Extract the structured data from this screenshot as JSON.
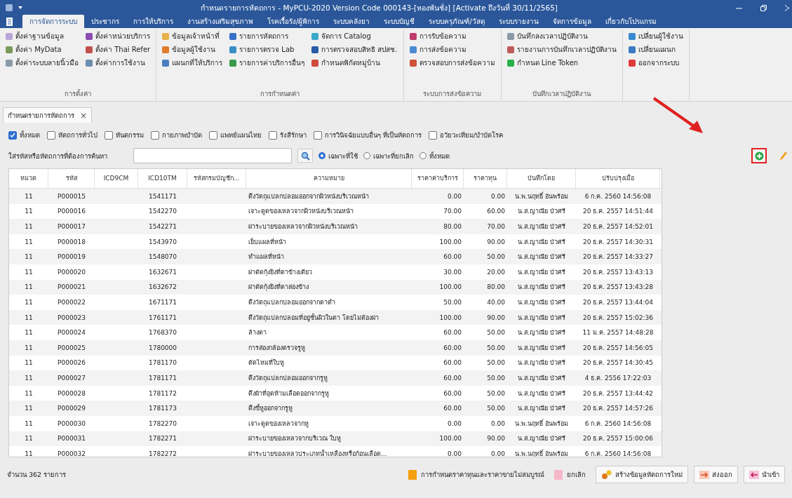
{
  "window": {
    "title": "กำหนดรายการหัตถการ - MyPCU-2020 Version Code 000143-[หองพันชั่ง] [Activate ถึงวันที่ 30/11/2565]"
  },
  "menu_tabs": [
    {
      "label": "การจัดการระบบ",
      "selected": true
    },
    {
      "label": "ประชากร",
      "selected": false
    },
    {
      "label": "การให้บริการ",
      "selected": false
    },
    {
      "label": "งานสร้างเสริมสุขภาพ",
      "selected": false
    },
    {
      "label": "โรคเรื้อรัง/ผู้พิการ",
      "selected": false
    },
    {
      "label": "ระบบคลังยา",
      "selected": false
    },
    {
      "label": "ระบบบัญชี",
      "selected": false
    },
    {
      "label": "ระบบครุภัณฑ์/วัสดุ",
      "selected": false
    },
    {
      "label": "ระบบรายงาน",
      "selected": false
    },
    {
      "label": "จัดการข้อมูล",
      "selected": false
    },
    {
      "label": "เกี่ยวกับโปรแกรม",
      "selected": false
    }
  ],
  "ribbon_groups": [
    {
      "label": "การตั้งค่า",
      "items": [
        {
          "label": "ตั้งค่าฐานข้อมูล",
          "color": "#b9a6d6"
        },
        {
          "label": "ตั้งค่า MyData",
          "color": "#7a9a5a"
        },
        {
          "label": "ตั้งค่าระบบลายนิ้วมือ",
          "color": "#8c9aa8"
        },
        {
          "label": "ตั้งค่าหน่วยบริการ",
          "color": "#8a4fb0"
        },
        {
          "label": "ตั้งค่า Thai Refer",
          "color": "#c0504d"
        },
        {
          "label": "ตั้งค่าการใช้งาน",
          "color": "#6b8cae"
        }
      ]
    },
    {
      "label": "การกำหนดค่า",
      "items": [
        {
          "label": "ข้อมูลเจ้าหน้าที่",
          "color": "#e8b04a"
        },
        {
          "label": "ข้อมูลผู้ใช้งาน",
          "color": "#e07b2a"
        },
        {
          "label": "แผนกที่ให้บริการ",
          "color": "#4a7fc1"
        },
        {
          "label": "รายการหัตถการ",
          "color": "#3a6fc8"
        },
        {
          "label": "รายการตรวจ Lab",
          "color": "#3a8fc8"
        },
        {
          "label": "รายการค่าบริการอื่นๆ",
          "color": "#3a9a4a"
        },
        {
          "label": "จัดการ Catalog",
          "color": "#3aa8c8"
        },
        {
          "label": "การตรวจสอบสิทธิ สปสช.",
          "color": "#2a5aa8"
        },
        {
          "label": "กำหนดพิกัดหมู่บ้าน",
          "color": "#d04a3a"
        }
      ]
    },
    {
      "label": "ระบบการส่งข้อความ",
      "items": [
        {
          "label": "การรับข้อความ",
          "color": "#c03a6a"
        },
        {
          "label": "การส่งข้อความ",
          "color": "#4a8ad0"
        },
        {
          "label": "ตรวจสอบการส่งข้อความ",
          "color": "#d0503a"
        }
      ]
    },
    {
      "label": "บันทึกเวลาปฏิบัติงาน",
      "items": [
        {
          "label": "บันทึกลงเวลาปฏิบัติงาน",
          "color": "#8c9aa8"
        },
        {
          "label": "รายงานการบันทึกเวลาปฏิบัติงาน",
          "color": "#c05a5a"
        },
        {
          "label": "กำหนด Line Token",
          "color": "#2ab04a"
        }
      ]
    },
    {
      "items": [
        {
          "label": "เปลี่ยนผู้ใช้งาน",
          "color": "#3a8ad0"
        },
        {
          "label": "เปลี่ยนแผนก",
          "color": "#3a7ac0"
        },
        {
          "label": "ออกจากระบบ",
          "color": "#e03a3a"
        }
      ]
    }
  ],
  "document_tab": {
    "label": "กำหนดรายการหัตถการ",
    "close": "×"
  },
  "filters": [
    {
      "label": "ทั้งหมด",
      "checked": true
    },
    {
      "label": "หัตถการทั่วไป",
      "checked": false
    },
    {
      "label": "ทันตกรรม",
      "checked": false
    },
    {
      "label": "กายภาพบำบัด",
      "checked": false
    },
    {
      "label": "แพทย์แผนไทย",
      "checked": false
    },
    {
      "label": "รังสีรักษา",
      "checked": false
    },
    {
      "label": "การวินิจฉัยแบบอื่นๆ ที่เป็นหัตถการ",
      "checked": false
    },
    {
      "label": "อวัยวะเทียม/บำบัดโรค",
      "checked": false
    }
  ],
  "search": {
    "label": "ใส่รหัสหรือหัตถการที่ต้องการค้นหา"
  },
  "status_options": [
    {
      "label": "เฉพาะที่ใช้",
      "selected": true
    },
    {
      "label": "เฉพาะที่ยกเลิก",
      "selected": false
    },
    {
      "label": "ทั้งหมด",
      "selected": false
    }
  ],
  "table": {
    "columns": [
      "หมวด",
      "รหัส",
      "ICD9CM",
      "ICD10TM",
      "รหัสกรมบัญชีก...",
      "ความหมาย",
      "ราคาค่าบริการ",
      "ราคาทุน",
      "บันทึกโดย",
      "ปรับปรุงเมื่อ"
    ],
    "rows": [
      [
        "11",
        "P000015",
        "",
        "1541171",
        "",
        "ดึงวัตถุแปลกปลอมออกจากผิวหนังบริเวณหน้า",
        "0.00",
        "0.00",
        "น.พ.นฤทธิ์ อันพร้อม",
        "6 ก.ค. 2560 14:56:08"
      ],
      [
        "11",
        "P000016",
        "",
        "1542270",
        "",
        "เจาะดูดของเหลวจากผิวหนังบริเวณหน้า",
        "70.00",
        "60.00",
        "น.ส.ญาณีย บัวศรี",
        "20 ธ.ค. 2557 14:51:44"
      ],
      [
        "11",
        "P000017",
        "",
        "1542271",
        "",
        "ผ่าระบายของเหลวจากผิวหนังบริเวณหน้า",
        "80.00",
        "70.00",
        "น.ส.ญาณีย บัวศรี",
        "20 ธ.ค. 2557 14:52:01"
      ],
      [
        "11",
        "P000018",
        "",
        "1543970",
        "",
        "เย็บแผลที่หน้า",
        "100.00",
        "90.00",
        "น.ส.ญาณีย บัวศรี",
        "20 ธ.ค. 2557 14:30:31"
      ],
      [
        "11",
        "P000019",
        "",
        "1548070",
        "",
        "ทำแผลที่หน้า",
        "60.00",
        "50.00",
        "น.ส.ญาณีย บัวศรี",
        "20 ธ.ค. 2557 14:33:27"
      ],
      [
        "11",
        "P000020",
        "",
        "1632671",
        "",
        "ผ่าตัดกุ้งยิงที่ตาข้างเดียว",
        "30.00",
        "20.00",
        "น.ส.ญาณีย บัวศรี",
        "20 ธ.ค. 2557 13:43:13"
      ],
      [
        "11",
        "P000021",
        "",
        "1632672",
        "",
        "ผ่าตัดกุ้งยิงที่ตาสองข้าง",
        "100.00",
        "80.00",
        "น.ส.ญาณีย บัวศรี",
        "20 ธ.ค. 2557 13:43:28"
      ],
      [
        "11",
        "P000022",
        "",
        "1671171",
        "",
        "ดึงวัตถุแปลกปลอมออกจากตาดำ",
        "50.00",
        "40.00",
        "น.ส.ญาณีย บัวศรี",
        "20 ธ.ค. 2557 13:44:04"
      ],
      [
        "11",
        "P000023",
        "",
        "1761171",
        "",
        "ดึงวัตถุแปลกปลอมที่อยู่ชั้นผิวในตา โดยไม่ต้องผ่า",
        "100.00",
        "90.00",
        "น.ส.ญาณีย บัวศรี",
        "20 ธ.ค. 2557 15:02:36"
      ],
      [
        "11",
        "P000024",
        "",
        "1768370",
        "",
        "ล้างตา",
        "60.00",
        "50.00",
        "น.ส.ญาณีย บัวศรี",
        "11 ม.ค. 2557 14:48:28"
      ],
      [
        "11",
        "P000025",
        "",
        "1780000",
        "",
        "การส่องกล้องตรวจรูหู",
        "60.00",
        "50.00",
        "น.ส.ญาณีย บัวศรี",
        "20 ธ.ค. 2557 14:56:05"
      ],
      [
        "11",
        "P000026",
        "",
        "1781170",
        "",
        "ตัดไหมที่ใบหู",
        "60.00",
        "50.00",
        "น.ส.ญาณีย บัวศรี",
        "20 ธ.ค. 2557 14:30:45"
      ],
      [
        "11",
        "P000027",
        "",
        "1781171",
        "",
        "ดึงวัตถุแปลกปลอมออกจากรูหู",
        "60.00",
        "50.00",
        "น.ส.ญาณีย บัวศรี",
        "4 ธ.ค. 2556 17:22:03"
      ],
      [
        "11",
        "P000028",
        "",
        "1781172",
        "",
        "ดึงผ้าที่อุดห้ามเลือดออกจากรูหู",
        "60.00",
        "50.00",
        "น.ส.ญาณีย บัวศรี",
        "20 ธ.ค. 2557 13:44:42"
      ],
      [
        "11",
        "P000029",
        "",
        "1781173",
        "",
        "ดึงขี้หูออกจากรูหู",
        "60.00",
        "50.00",
        "น.ส.ญาณีย บัวศรี",
        "20 ธ.ค. 2557 14:57:26"
      ],
      [
        "11",
        "P000030",
        "",
        "1782270",
        "",
        "เจาะดูดของเหลวจากหู",
        "0.00",
        "0.00",
        "น.พ.นฤทธิ์ อันพร้อม",
        "6 ก.ค. 2560 14:56:08"
      ],
      [
        "11",
        "P000031",
        "",
        "1782271",
        "",
        "ผ่าระบายของเหลวจากบริเวณ ใบหู",
        "100.00",
        "90.00",
        "น.ส.ญาณีย บัวศรี",
        "20 ธ.ค. 2557 15:00:06"
      ],
      [
        "11",
        "P000032",
        "",
        "1782272",
        "",
        "ผ่าระบายของเหลวประเภทน้ำเหลืองหรือก้อนเลือด...",
        "0.00",
        "0.00",
        "น.พ.นฤทธิ์ อันพร้อม",
        "6 ก.ค. 2560 14:56:08"
      ]
    ]
  },
  "footer": {
    "count": "จำนวน 362 รายการ",
    "legend": [
      {
        "label": "การกำหนดราคาทุนและราคาขายไม่สมบูรณ์",
        "color": "#f5a00f"
      },
      {
        "label": "ยกเลิก",
        "color": "#f6b8c8"
      }
    ],
    "buttons": [
      {
        "label": "สร้างข้อมูลหัตถการใหม่",
        "kind": "gears"
      },
      {
        "label": "ส่งออก",
        "kind": "export"
      },
      {
        "label": "นำเข้า",
        "kind": "import"
      }
    ]
  }
}
